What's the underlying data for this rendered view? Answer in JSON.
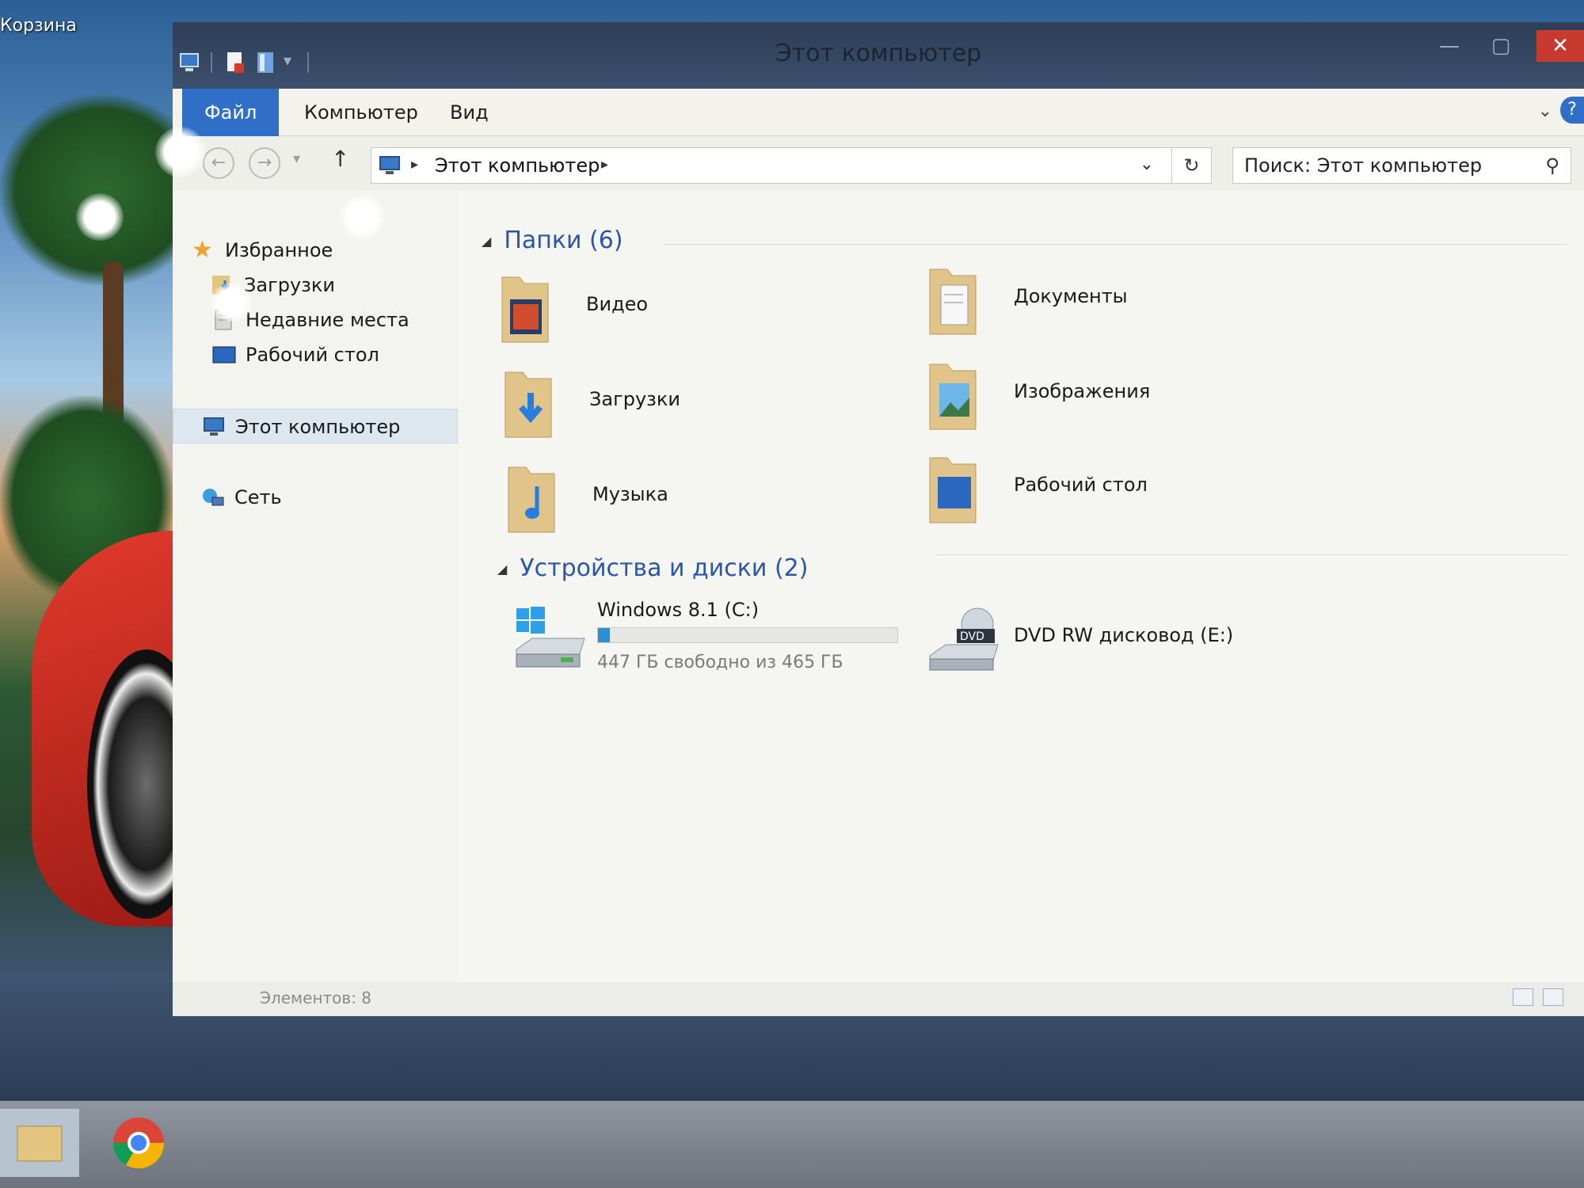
{
  "desktop": {
    "recycle_bin_label": "Корзина"
  },
  "window": {
    "title": "Этот компьютер"
  },
  "ribbon": {
    "tabs": [
      {
        "label": "Файл"
      },
      {
        "label": "Компьютер"
      },
      {
        "label": "Вид"
      }
    ]
  },
  "address": {
    "path": "Этот компьютер"
  },
  "search": {
    "placeholder": "Поиск: Этот компьютер"
  },
  "sidebar": {
    "favorites_label": "Избранное",
    "favorites": [
      {
        "label": "Загрузки"
      },
      {
        "label": "Недавние места"
      },
      {
        "label": "Рабочий стол"
      }
    ],
    "this_pc_label": "Этот компьютер",
    "network_label": "Сеть"
  },
  "folders_group": {
    "title": "Папки (6)",
    "items": [
      {
        "label": "Видео",
        "icon": "video-folder-icon"
      },
      {
        "label": "Документы",
        "icon": "documents-folder-icon"
      },
      {
        "label": "Загрузки",
        "icon": "downloads-folder-icon"
      },
      {
        "label": "Изображения",
        "icon": "pictures-folder-icon"
      },
      {
        "label": "Музыка",
        "icon": "music-folder-icon"
      },
      {
        "label": "Рабочий стол",
        "icon": "desktop-folder-icon"
      }
    ]
  },
  "devices_group": {
    "title": "Устройства и диски (2)",
    "items": [
      {
        "label": "Windows 8.1 (C:)",
        "free_text": "447 ГБ свободно из 465 ГБ",
        "used_fraction": 0.04
      },
      {
        "label": "DVD RW дисковод (E:)"
      }
    ]
  },
  "status": {
    "items_text": "Элементов: 8"
  },
  "colors": {
    "accent": "#2f6fc8",
    "group_header": "#2a56a8",
    "drive_bar": "#2b8fd6",
    "close": "#c93a2e"
  }
}
